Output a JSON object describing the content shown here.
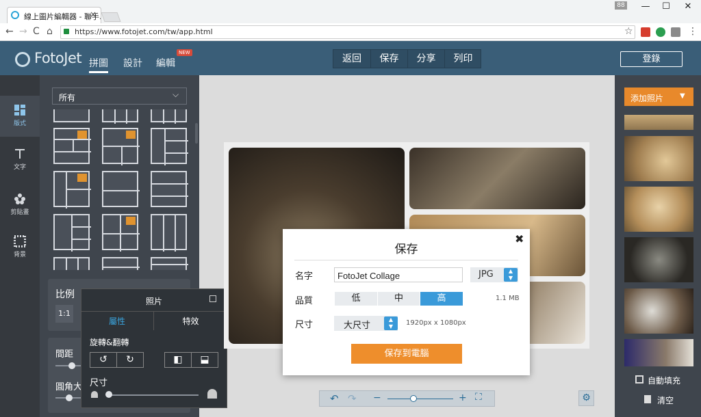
{
  "browser": {
    "tab_title": "線上圖片編輯器 - 聯手…",
    "tab_close": "×",
    "badge": "88",
    "win_min": "—",
    "win_max": "☐",
    "win_close": "✕",
    "back": "←",
    "forward": "→",
    "reload": "C",
    "home": "⌂",
    "url": "https://www.fotojet.com/tw/app.html",
    "star": "☆",
    "menu": "⋮",
    "ext_colors": [
      "#d63d2e",
      "#2b9e50",
      "#8a8a8a",
      "#9a9a9a"
    ]
  },
  "header": {
    "logo": "FotoJet",
    "tabs": [
      "拼圖",
      "設計",
      "編輯"
    ],
    "active_tab": "拼圖",
    "new_badge": "NEW",
    "actions": [
      "返回",
      "保存",
      "分享",
      "列印"
    ],
    "login": "登錄",
    "colors": {
      "bar": "#3a5e78"
    }
  },
  "left_nav": {
    "items": [
      "版式",
      "文字",
      "剪貼畫",
      "背景"
    ],
    "active": "版式"
  },
  "layout_panel": {
    "filter": "所有",
    "chevron": "⌵",
    "ratio_label": "比例",
    "ratio_value": "1:1",
    "spacing_label": "間距",
    "radius_label": "圓角大"
  },
  "photo_popup": {
    "title": "照片",
    "tabs": [
      "屬性",
      "特效"
    ],
    "active_tab": "屬性",
    "rotate_label": "旋轉&翻轉",
    "rotate_left": "↺",
    "rotate_right": "↻",
    "flip_h": "◧",
    "flip_v": "⬓",
    "size_label": "尺寸"
  },
  "right_panel": {
    "add_photo": "添加照片",
    "caret": "▼",
    "autofill": "自動填充",
    "clear": "清空"
  },
  "zoom_bar": {
    "undo": "↶",
    "redo": "↷",
    "minus": "−",
    "plus": "+",
    "fit": "⛶",
    "settings": "⚙",
    "zoom_level": 0.4
  },
  "save_dialog": {
    "title": "保存",
    "close": "✖",
    "name_label": "名字",
    "name_value": "FotoJet Collage",
    "format": "JPG",
    "quality_label": "品質",
    "quality_options": [
      "低",
      "中",
      "高"
    ],
    "quality_selected": "高",
    "file_size": "1.1 MB",
    "size_label": "尺寸",
    "size_value": "大尺寸",
    "dimensions": "1920px x 1080px",
    "save_button": "保存到電腦",
    "colors": {
      "accent": "#3a9ad9",
      "save": "#ee8e2c"
    }
  }
}
